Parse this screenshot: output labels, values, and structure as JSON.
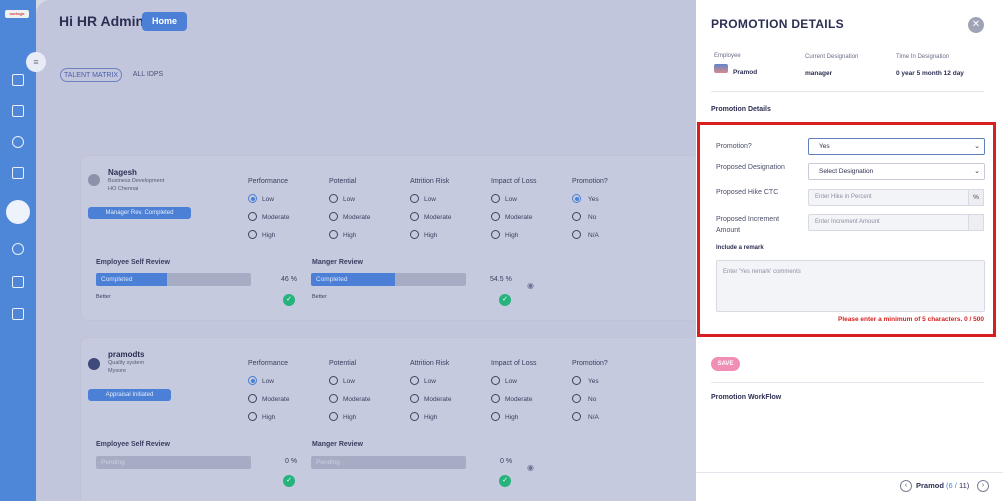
{
  "app": {
    "logo_text": "ourlogo",
    "greeting": "Hi HR Admin",
    "home_label": "Home"
  },
  "tabs": [
    {
      "label": "TALENT MATRIX"
    },
    {
      "label": "ALL IDPS"
    }
  ],
  "columns": {
    "performance": "Performance",
    "potential": "Potential",
    "attrition": "Attrition Risk",
    "impact": "Impact of Loss",
    "promotion": "Promotion?"
  },
  "options": {
    "low": "Low",
    "moderate": "Moderate",
    "high": "High",
    "yes": "Yes",
    "no": "No",
    "na": "N/A"
  },
  "reviews": {
    "self": "Employee Self Review",
    "manager": "Manger Review"
  },
  "cards": [
    {
      "name": "Nagesh",
      "department": "Business Development",
      "location": "HO Chennai",
      "status": "Manager Rev. Completed",
      "self_status": "Completed",
      "self_pct": "46 %",
      "self_progress": 0.46,
      "mgr_status": "Completed",
      "mgr_pct": "54.5 %",
      "mgr_progress": 0.545,
      "self_note": "Better",
      "mgr_note": "Better"
    },
    {
      "name": "pramodts",
      "department": "Quality system",
      "location": "Mysore",
      "status": "Appraisal Initiated",
      "self_status": "Pending",
      "self_pct": "0 %",
      "self_progress": 0,
      "mgr_status": "Pending",
      "mgr_pct": "0 %",
      "mgr_progress": 0
    }
  ],
  "drawer": {
    "title": "PROMOTION DETAILS",
    "employee_label": "Employee",
    "employee_name": "Pramod",
    "designation_label": "Current Designation",
    "designation_value": "manager",
    "time_label": "Time In Designation",
    "time_value": "0 year 5 month 12 day",
    "section_title": "Promotion Details",
    "promotion_label": "Promotion?",
    "promotion_value": "Yes",
    "proposed_designation_label": "Proposed Designation",
    "proposed_designation_value": "Select Designation",
    "hike_label": "Proposed Hike CTC",
    "hike_placeholder": "Enter Hike in Percent",
    "hike_suffix": "%",
    "increment_label": "Proposed Increment Amount",
    "increment_placeholder": "Enter Increment Amount",
    "remark_label": "Include a remark",
    "remark_placeholder": "Enter 'Yes remark' comments",
    "error": "Please enter a minimum of 5 characters. 0 / 500",
    "save_label": "SAVE",
    "workflow_title": "Promotion WorkFlow",
    "pager": {
      "name": "Pramod",
      "current": "6",
      "separator": "/",
      "total": "11"
    }
  },
  "colors": {
    "accent": "#4b80d6",
    "error": "#d81e1e",
    "success": "#27b37c",
    "save": "#f08eb5"
  }
}
